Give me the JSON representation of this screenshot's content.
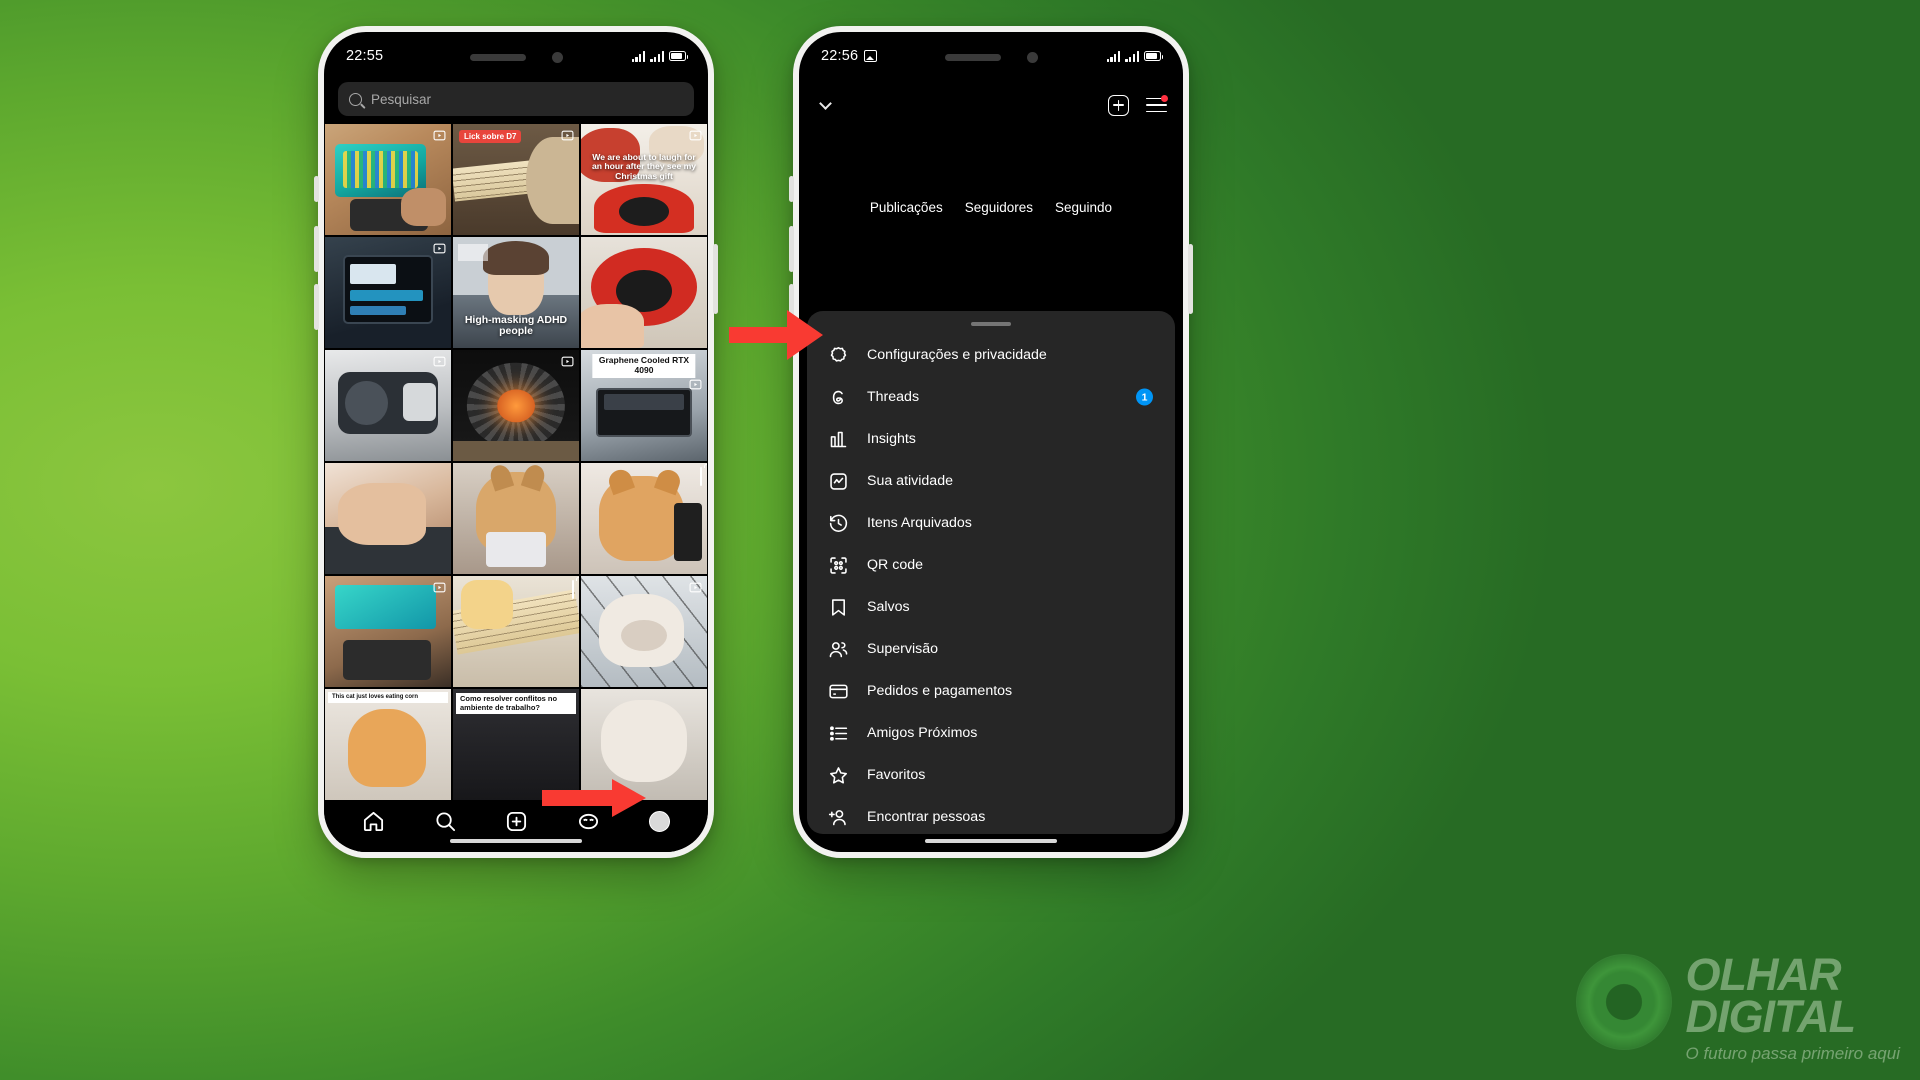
{
  "phone_left": {
    "status": {
      "time": "22:55"
    },
    "search": {
      "placeholder": "Pesquisar",
      "icon": "search-icon"
    },
    "grid": [
      {
        "id": "cell-1",
        "badge": "reel",
        "overlay": ""
      },
      {
        "id": "cell-2",
        "badge": "reel",
        "tag_red": "Lick sobre D7"
      },
      {
        "id": "cell-3",
        "badge": "reel",
        "overlay": "We are about to laugh for an hour after they see my Christmas gift"
      },
      {
        "id": "cell-4",
        "badge": "reel",
        "overlay": ""
      },
      {
        "id": "cell-5",
        "badge": "",
        "overlay": "High-masking ADHD people"
      },
      {
        "id": "cell-6",
        "badge": "",
        "overlay": ""
      },
      {
        "id": "cell-7",
        "badge": "reel",
        "overlay": ""
      },
      {
        "id": "cell-8",
        "badge": "reel",
        "overlay": ""
      },
      {
        "id": "cell-9",
        "badge": "reel",
        "tag_white": "Graphene Cooled RTX 4090"
      },
      {
        "id": "cell-10",
        "badge": "",
        "overlay": ""
      },
      {
        "id": "cell-11",
        "badge": "",
        "overlay": ""
      },
      {
        "id": "cell-12",
        "badge": "multi",
        "overlay": ""
      },
      {
        "id": "cell-13",
        "badge": "reel",
        "overlay": ""
      },
      {
        "id": "cell-14",
        "badge": "multi",
        "overlay": ""
      },
      {
        "id": "cell-15",
        "badge": "reel",
        "overlay": ""
      },
      {
        "id": "cell-16",
        "badge": "",
        "tag_white": "This cat just loves eating corn"
      },
      {
        "id": "cell-17",
        "badge": "",
        "tag_white": "Como resolver conflitos no ambiente de trabalho?"
      },
      {
        "id": "cell-18",
        "badge": "",
        "overlay": ""
      }
    ],
    "tabbar": [
      {
        "name": "home-icon",
        "label": "Início"
      },
      {
        "name": "search-icon",
        "label": "Pesquisar"
      },
      {
        "name": "create-icon",
        "label": "Criar"
      },
      {
        "name": "reels-icon",
        "label": "Reels"
      },
      {
        "name": "profile-avatar",
        "label": "Perfil"
      }
    ]
  },
  "phone_right": {
    "status": {
      "time": "22:56",
      "image_icon": "screenshot-icon"
    },
    "header": {
      "username": "",
      "chevron": "chevron-down-icon",
      "add_label": "plus-square-icon",
      "menu_label": "hamburger-icon"
    },
    "stats": [
      {
        "label": "Publicações"
      },
      {
        "label": "Seguidores"
      },
      {
        "label": "Seguindo"
      }
    ],
    "sheet": {
      "items": [
        {
          "icon": "settings-gear-icon",
          "label": "Configurações e privacidade",
          "badge": ""
        },
        {
          "icon": "threads-icon",
          "label": "Threads",
          "badge": "1"
        },
        {
          "icon": "insights-bar-icon",
          "label": "Insights",
          "badge": ""
        },
        {
          "icon": "activity-icon",
          "label": "Sua atividade",
          "badge": ""
        },
        {
          "icon": "archive-clock-icon",
          "label": "Itens Arquivados",
          "badge": ""
        },
        {
          "icon": "qr-code-icon",
          "label": "QR code",
          "badge": ""
        },
        {
          "icon": "bookmark-icon",
          "label": "Salvos",
          "badge": ""
        },
        {
          "icon": "supervision-users-icon",
          "label": "Supervisão",
          "badge": ""
        },
        {
          "icon": "credit-card-icon",
          "label": "Pedidos e pagamentos",
          "badge": ""
        },
        {
          "icon": "close-friends-list-icon",
          "label": "Amigos Próximos",
          "badge": ""
        },
        {
          "icon": "star-icon",
          "label": "Favoritos",
          "badge": ""
        },
        {
          "icon": "add-person-icon",
          "label": "Encontrar pessoas",
          "badge": ""
        }
      ]
    }
  },
  "annotations": {
    "arrow_to_menu": "red-arrow-right",
    "arrow_to_profile": "red-arrow-right"
  },
  "watermark": {
    "line1": "OLHAR",
    "line2": "DIGITAL",
    "tagline": "O futuro passa primeiro aqui"
  },
  "colors": {
    "background_green": "#5DA82E",
    "sheet_bg": "#262626",
    "accent_blue": "#0095f6",
    "accent_red": "#FF3B30",
    "tag_red": "#e8453c"
  }
}
